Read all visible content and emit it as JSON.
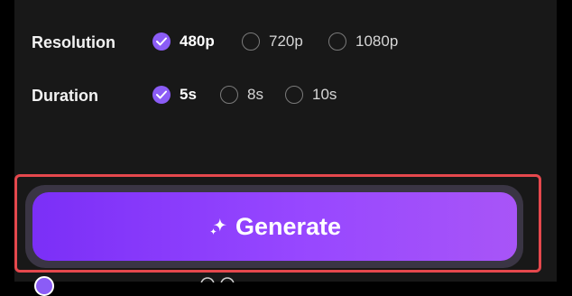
{
  "settings": {
    "resolution": {
      "label": "Resolution",
      "options": [
        {
          "label": "480p",
          "selected": true
        },
        {
          "label": "720p",
          "selected": false
        },
        {
          "label": "1080p",
          "selected": false
        }
      ]
    },
    "duration": {
      "label": "Duration",
      "options": [
        {
          "label": "5s",
          "selected": true
        },
        {
          "label": "8s",
          "selected": false
        },
        {
          "label": "10s",
          "selected": false
        }
      ]
    }
  },
  "generate": {
    "label": "Generate",
    "icon": "sparkle-icon"
  },
  "colors": {
    "accent": "#8b5cf6",
    "panel_bg": "#181818",
    "button_gradient": [
      "#7b2ff7",
      "#a855f7"
    ],
    "highlight_outline": "#e5484d"
  }
}
